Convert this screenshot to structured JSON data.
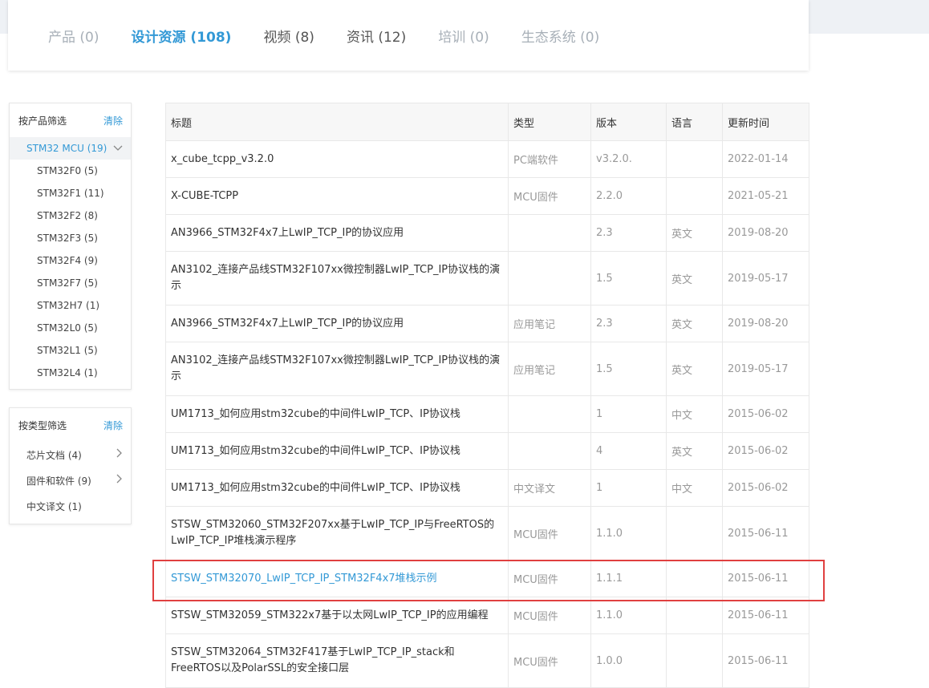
{
  "tabs": [
    {
      "label": "产品",
      "count": "(0)"
    },
    {
      "label": "设计资源",
      "count": "(108)"
    },
    {
      "label": "视频",
      "count": "(8)"
    },
    {
      "label": "资讯",
      "count": "(12)"
    },
    {
      "label": "培训",
      "count": "(0)"
    },
    {
      "label": "生态系统",
      "count": "(0)"
    }
  ],
  "product_filter": {
    "title": "按产品筛选",
    "clear": "清除",
    "group": "STM32 MCU (19)",
    "items": [
      "STM32F0 (5)",
      "STM32F1 (11)",
      "STM32F2 (8)",
      "STM32F3 (5)",
      "STM32F4 (9)",
      "STM32F7 (5)",
      "STM32H7 (1)",
      "STM32L0 (5)",
      "STM32L1 (5)",
      "STM32L4 (1)"
    ]
  },
  "type_filter": {
    "title": "按类型筛选",
    "clear": "清除",
    "items": [
      "芯片文档 (4)",
      "固件和软件 (9)",
      "中文译文 (1)"
    ]
  },
  "table": {
    "headers": [
      "标题",
      "类型",
      "版本",
      "语言",
      "更新时间"
    ],
    "rows": [
      {
        "title": "x_cube_tcpp_v3.2.0",
        "type": "PC端软件",
        "version": "v3.2.0.",
        "lang": "",
        "date": "2022-01-14"
      },
      {
        "title": "X-CUBE-TCPP",
        "type": "MCU固件",
        "version": "2.2.0",
        "lang": "",
        "date": "2021-05-21"
      },
      {
        "title": "AN3966_STM32F4x7上LwIP_TCP_IP的协议应用",
        "type": "",
        "version": "2.3",
        "lang": "英文",
        "date": "2019-08-20"
      },
      {
        "title": "AN3102_连接产品线STM32F107xx微控制器LwIP_TCP_IP协议栈的演示",
        "type": "",
        "version": "1.5",
        "lang": "英文",
        "date": "2019-05-17"
      },
      {
        "title": "AN3966_STM32F4x7上LwIP_TCP_IP的协议应用",
        "type": "应用笔记",
        "version": "2.3",
        "lang": "英文",
        "date": "2019-08-20"
      },
      {
        "title": "AN3102_连接产品线STM32F107xx微控制器LwIP_TCP_IP协议栈的演示",
        "type": "应用笔记",
        "version": "1.5",
        "lang": "英文",
        "date": "2019-05-17"
      },
      {
        "title": "UM1713_如何应用stm32cube的中间件LwIP_TCP、IP协议栈",
        "type": "",
        "version": "1",
        "lang": "中文",
        "date": "2015-06-02"
      },
      {
        "title": "UM1713_如何应用stm32cube的中间件LwIP_TCP、IP协议栈",
        "type": "",
        "version": "4",
        "lang": "英文",
        "date": "2015-06-02"
      },
      {
        "title": "UM1713_如何应用stm32cube的中间件LwIP_TCP、IP协议栈",
        "type": "中文译文",
        "version": "1",
        "lang": "中文",
        "date": "2015-06-02"
      },
      {
        "title": "STSW_STM32060_STM32F207xx基于LwIP_TCP_IP与FreeRTOS的LwIP_TCP_IP堆栈演示程序",
        "type": "MCU固件",
        "version": "1.1.0",
        "lang": "",
        "date": "2015-06-11"
      },
      {
        "title": "STSW_STM32070_LwIP_TCP_IP_STM32F4x7堆栈示例",
        "type": "MCU固件",
        "version": "1.1.1",
        "lang": "",
        "date": "2015-06-11"
      },
      {
        "title": "STSW_STM32059_STM322x7基于以太网LwIP_TCP_IP的应用编程",
        "type": "MCU固件",
        "version": "1.1.0",
        "lang": "",
        "date": "2015-06-11"
      },
      {
        "title": "STSW_STM32064_STM32F417基于LwIP_TCP_IP_stack和FreeRTOS以及PolarSSL的安全接口层",
        "type": "MCU固件",
        "version": "1.0.0",
        "lang": "",
        "date": "2015-06-11"
      }
    ]
  },
  "colors": {
    "accent": "#3399d6",
    "highlight_box": "#e04040"
  }
}
